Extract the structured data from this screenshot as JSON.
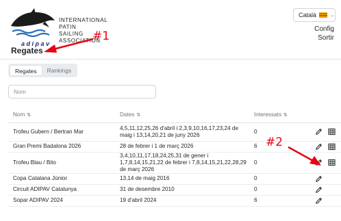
{
  "brand": {
    "logo_lines": [
      "INTERNATIONAL",
      "PATIN",
      "SAILING",
      "ASSOCIATION"
    ],
    "logo_sub": "adipav"
  },
  "header": {
    "language": "Català",
    "nav": {
      "config": "Config",
      "sortir": "Sortir"
    }
  },
  "page": {
    "title": "Regates"
  },
  "annotations": {
    "a1": "#1",
    "a2": "#2",
    "color": "#e30613"
  },
  "tabs": [
    {
      "label": "Regates",
      "active": true
    },
    {
      "label": "Rankings",
      "active": false
    }
  ],
  "search": {
    "placeholder": "Nom",
    "value": ""
  },
  "table": {
    "columns": {
      "nom": "Nom",
      "dates": "Dates",
      "interessats": "Interessats"
    },
    "sort_icon": "⇅",
    "rows": [
      {
        "nom": "Trofeu Gubern / Bertran Mar",
        "dates": "4,5,11,12,25,26 d'abril i 2,3,9,10,16,17,23,24 de maig i 13,14,20,21 de juny 2026",
        "interessats": "0",
        "actions": [
          "edit-icon",
          "grid-icon"
        ]
      },
      {
        "nom": "Gran Premi Badalona 2026",
        "dates": "28 de febrer i 1 de març 2026",
        "interessats": "6",
        "actions": [
          "edit-icon",
          "grid-icon"
        ]
      },
      {
        "nom": "Trofeu Blau / Bito",
        "dates": "3,4,10,11,17,18,24,25,31 de gener i 1,7,8,14,15,21,22 de febrer i 7,8,14,15,21,22,28,29 de març 2026",
        "interessats": "0",
        "actions": [
          "edit-icon",
          "grid-icon"
        ]
      },
      {
        "nom": "Copa Catalana Júnior",
        "dates": "13,14 de maig 2016",
        "interessats": "0",
        "actions": [
          "edit-icon"
        ]
      },
      {
        "nom": "Circuit ADIPAV Catalunya",
        "dates": "31 de desembre 2010",
        "interessats": "0",
        "actions": [
          "edit-icon"
        ]
      },
      {
        "nom": "Sopar ADIPAV 2024",
        "dates": "19 d'abril 2024",
        "interessats": "6",
        "actions": [
          "edit-icon"
        ]
      }
    ]
  }
}
